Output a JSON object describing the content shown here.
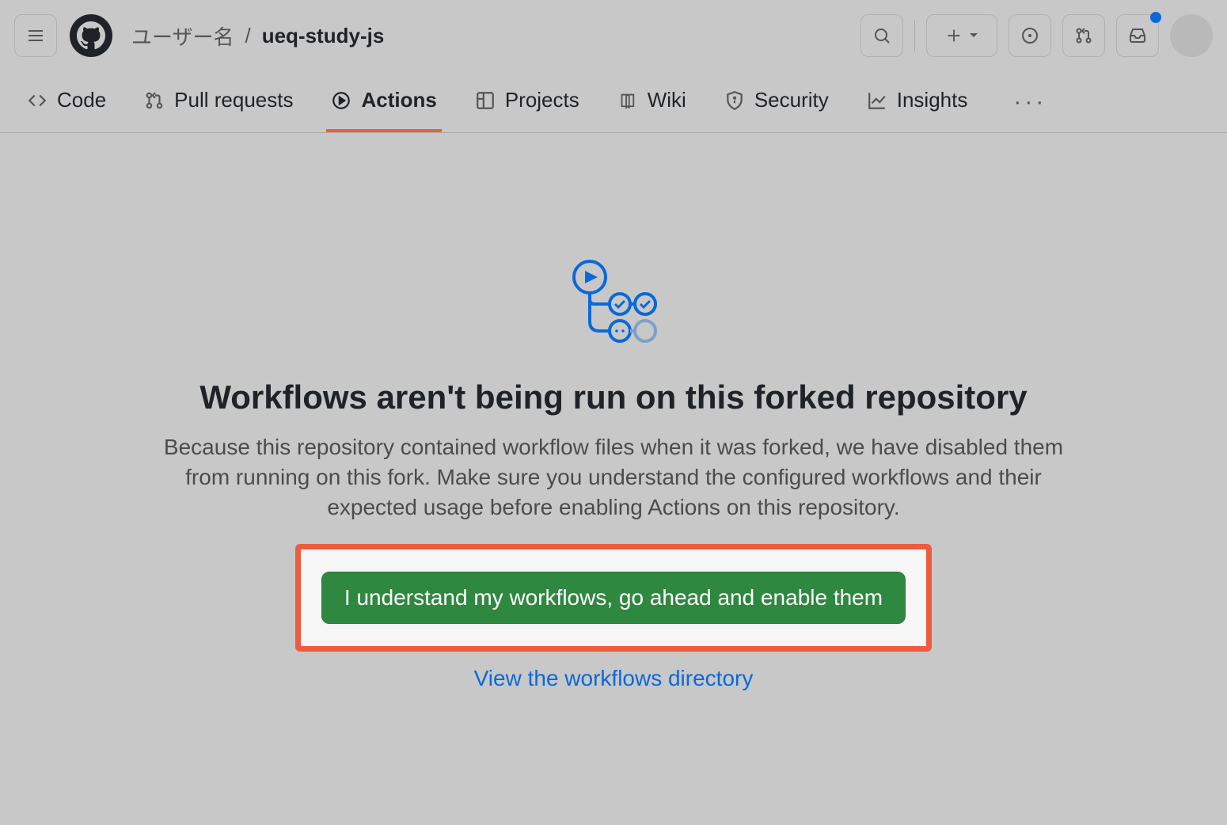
{
  "header": {
    "owner": "ユーザー名",
    "separator": "/",
    "repo": "ueq-study-js"
  },
  "tabs": {
    "code": "Code",
    "pulls": "Pull requests",
    "actions": "Actions",
    "projects": "Projects",
    "wiki": "Wiki",
    "security": "Security",
    "insights": "Insights"
  },
  "main": {
    "title": "Workflows aren't being run on this forked repository",
    "desc": "Because this repository contained workflow files when it was forked, we have disabled them from running on this fork. Make sure you understand the configured workflows and their expected usage before enabling Actions on this repository.",
    "enable_label": "I understand my workflows, go ahead and enable them",
    "view_link": "View the workflows directory"
  }
}
